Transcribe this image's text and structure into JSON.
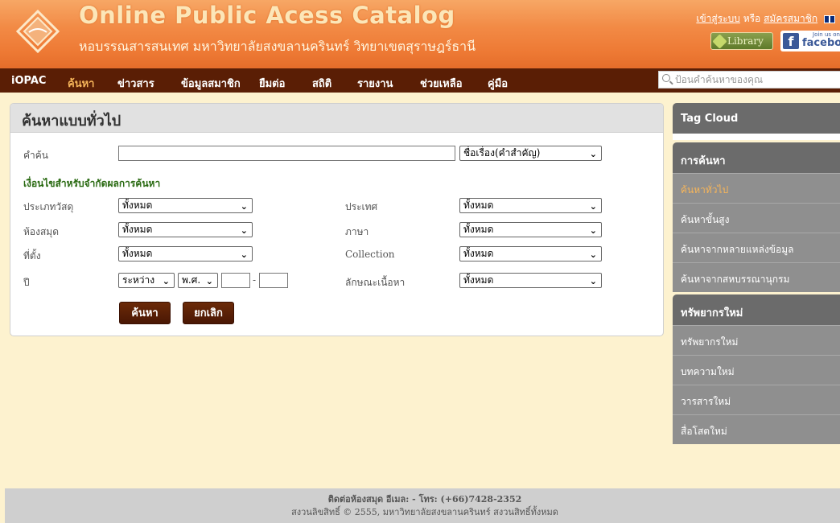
{
  "header": {
    "title": "Online Public Acess Catalog",
    "subtitle": "หอบรรณสารสนเทศ มหาวิทยาลัยสงขลานครินทร์ วิทยาเขตสุราษฎร์ธานี",
    "login": "เข้าสู่ระบบ",
    "or": "หรือ",
    "register": "สมัครสมาชิก",
    "library_button": "Library",
    "facebook_join": "Join us on",
    "facebook_label": "facebook"
  },
  "nav": {
    "brand": "iOPAC",
    "items": [
      "ค้นหา",
      "ข่าวสาร",
      "ข้อมูลสมาชิก",
      "ยืมต่อ",
      "สถิติ",
      "รายงาน",
      "ช่วยเหลือ",
      "คู่มือ"
    ],
    "search_placeholder": "ป้อนคำค้นหาของคุณ"
  },
  "form": {
    "title": "ค้นหาแบบทั่วไป",
    "keyword_label": "คำค้น",
    "keyword_value": "",
    "field_select": "ชื่อเรื่อง(คำสำคัญ)",
    "filter_heading": "เงื่อนไขสำหรับจำกัดผลการค้นหา",
    "material_type_label": "ประเภทวัสดุ",
    "material_type_value": "ทั้งหมด",
    "library_label": "ห้องสมุด",
    "library_value": "ทั้งหมด",
    "location_label": "ที่ตั้ง",
    "location_value": "ทั้งหมด",
    "year_label": "ปี",
    "year_mode": "ระหว่าง",
    "year_era": "พ.ศ.",
    "year_separator": "-",
    "country_label": "ประเทศ",
    "country_value": "ทั้งหมด",
    "language_label": "ภาษา",
    "language_value": "ทั้งหมด",
    "collection_label": "Collection",
    "collection_value": "ทั้งหมด",
    "content_label": "ลักษณะเนื้อหา",
    "content_value": "ทั้งหมด",
    "search_button": "ค้นหา",
    "cancel_button": "ยกเลิก"
  },
  "sidebar": {
    "tag_cloud": "Tag Cloud",
    "search_head": "การค้นหา",
    "search_items": [
      "ค้นหาทั่วไป",
      "ค้นหาขั้นสูง",
      "ค้นหาจากหลายแหล่งข้อมูล",
      "ค้นหาจากสหบรรณานุกรม"
    ],
    "new_head": "ทรัพยากรใหม่",
    "new_items": [
      "ทรัพยากรใหม่",
      "บทความใหม่",
      "วารสารใหม่",
      "สื่อโสตใหม่"
    ]
  },
  "footer": {
    "contact": "ติดต่อห้องสมุด อีเมล: - โทร: (+66)7428-2352",
    "copyright": "สงวนลิขสิทธิ์ © 2555, มหาวิทยาลัยสงขลานครินทร์ สงวนสิทธิ์ทั้งหมด"
  }
}
